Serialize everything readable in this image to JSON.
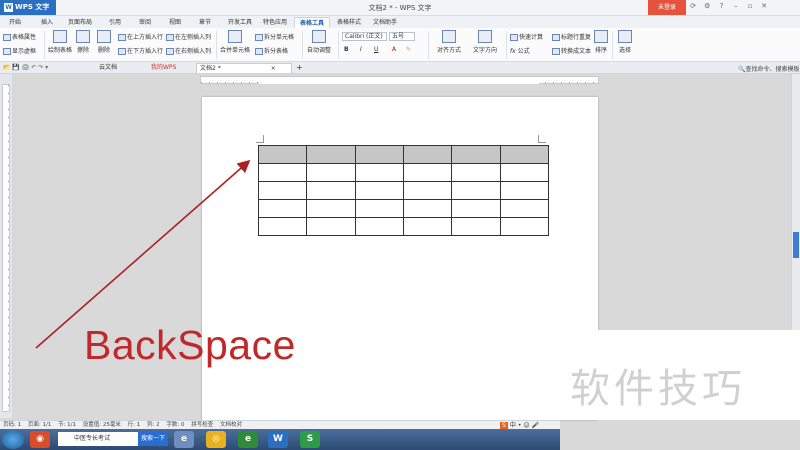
{
  "titlebar": {
    "app_name": "WPS 文字",
    "app_logo": "W",
    "doc_title": "文档2 * - WPS 文字",
    "login_label": "未登录",
    "window_icons": [
      "skin-icon",
      "settings-icon",
      "help-icon",
      "minimize-icon",
      "restore-icon",
      "close-icon"
    ],
    "window_glyphs": [
      "⟳",
      "⚙",
      "?",
      "–",
      "▫",
      "✕"
    ]
  },
  "menu": {
    "tabs": [
      "开始",
      "插入",
      "页面布局",
      "引用",
      "审阅",
      "视图",
      "章节",
      "开发工具",
      "特色应用",
      "表格工具",
      "表格样式",
      "文档助手"
    ],
    "active": "表格工具"
  },
  "ribbon": {
    "table_props": "表格属性",
    "show_gridlines": "显示虚框",
    "draw_table": "绘制表格",
    "erase": "擦除",
    "delete": "删除",
    "insert_above": "在上方插入行",
    "insert_below": "在下方插入行",
    "insert_left": "在左侧插入列",
    "insert_right": "在右侧插入列",
    "merge_cells": "合并单元格",
    "split_cells": "拆分单元格",
    "split_table": "拆分表格",
    "autofit": "自动调整",
    "font_name": "Calibri (正文)",
    "font_size": "五号",
    "align": "对齐方式",
    "text_direction": "文字方向",
    "quick_calc": "快速计算",
    "formula": "公式",
    "repeat_header": "标题行重复",
    "convert_text": "转换成文本",
    "sort": "排序",
    "select": "选择"
  },
  "doctabs": {
    "items": [
      "云文档",
      "我的WPS",
      "文档2 *"
    ],
    "search": "查找命令、搜索模板"
  },
  "overlay": {
    "label": "BackSpace",
    "watermark": "软件技巧"
  },
  "status": {
    "items": [
      "页码: 1",
      "页面: 1/1",
      "节: 1/1",
      "设置值: 25毫米",
      "行: 1",
      "列: 2",
      "字数: 0",
      "拼写检查",
      "文档校对"
    ],
    "ime": "中"
  },
  "taskbar": {
    "search_value": "中医专长考试",
    "search_button": "搜索一下",
    "app_w": "W",
    "app_s": "S"
  },
  "colors": {
    "accent": "#2b6fc2",
    "annotation": "#c0282a",
    "header_fill": "#c6c6c6"
  }
}
